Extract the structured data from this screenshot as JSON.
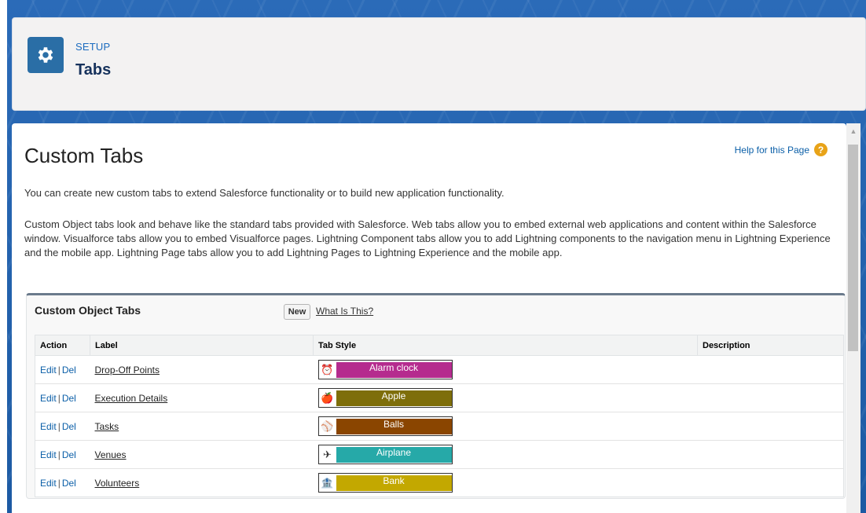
{
  "header": {
    "section_label": "SETUP",
    "title": "Tabs",
    "icon": "gear-icon"
  },
  "page": {
    "heading": "Custom Tabs",
    "help_link": "Help for this Page",
    "intro": "You can create new custom tabs to extend Salesforce functionality or to build new application functionality.",
    "description": "Custom Object tabs look and behave like the standard tabs provided with Salesforce. Web tabs allow you to embed external web applications and content within the Salesforce window. Visualforce tabs allow you to embed Visualforce pages. Lightning Component tabs allow you to add Lightning components to the navigation menu in Lightning Experience and the mobile app. Lightning Page tabs allow you to add Lightning Pages to Lightning Experience and the mobile app."
  },
  "custom_object_tabs": {
    "title": "Custom Object Tabs",
    "new_button": "New",
    "what_is_this": "What Is This?",
    "columns": [
      "Action",
      "Label",
      "Tab Style",
      "Description"
    ],
    "action_edit": "Edit",
    "action_separator": "|",
    "action_del": "Del",
    "rows": [
      {
        "label": "Drop-Off Points",
        "style": "Alarm clock",
        "color": "#b52b8e",
        "icon": "alarm-clock-icon",
        "description": ""
      },
      {
        "label": "Execution Details",
        "style": "Apple",
        "color": "#7e6e0a",
        "icon": "apple-icon",
        "description": ""
      },
      {
        "label": "Tasks",
        "style": "Balls",
        "color": "#8a4500",
        "icon": "balls-icon",
        "description": ""
      },
      {
        "label": "Venues",
        "style": "Airplane",
        "color": "#26a9a8",
        "icon": "airplane-icon",
        "description": ""
      },
      {
        "label": "Volunteers",
        "style": "Bank",
        "color": "#c3a800",
        "icon": "bank-icon",
        "description": ""
      }
    ]
  }
}
